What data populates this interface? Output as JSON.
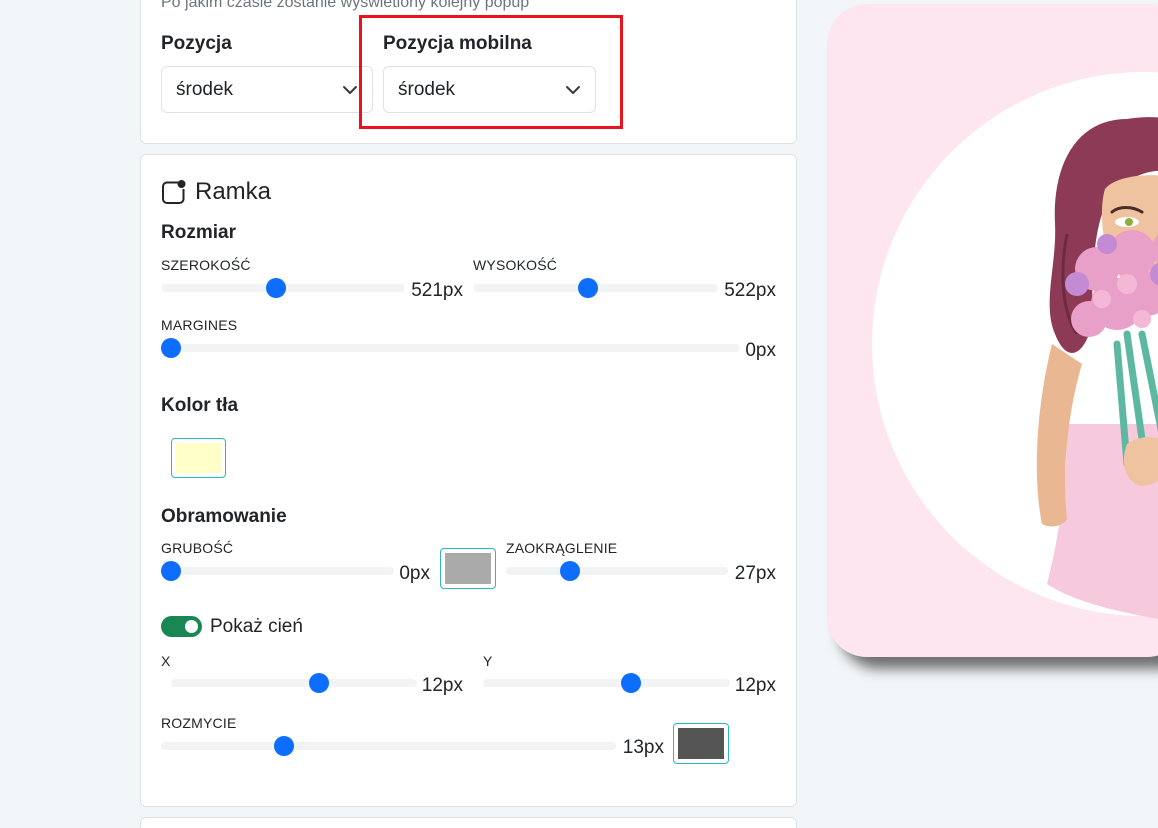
{
  "top_card": {
    "hint": "Po jakim czasie zostanie wyświetlony kolejny popup",
    "position_label": "Pozycja",
    "position_value": "środek",
    "mobile_position_label": "Pozycja mobilna",
    "mobile_position_value": "środek"
  },
  "frame": {
    "title": "Ramka",
    "size_heading": "Rozmiar",
    "width": {
      "label": "SZEROKOŚĆ",
      "value": "521px",
      "fraction": 0.47
    },
    "height": {
      "label": "WYSOKOŚĆ",
      "value": "522px",
      "fraction": 0.47
    },
    "margin": {
      "label": "MARGINES",
      "value": "0px",
      "fraction": 0.0
    },
    "bg_color_heading": "Kolor tła",
    "bg_color": "#ffffc8",
    "border_heading": "Obramowanie",
    "thickness": {
      "label": "GRUBOŚĆ",
      "value": "0px",
      "fraction": 0.0
    },
    "border_color": "#aaaaaa",
    "radius": {
      "label": "ZAOKRĄGLENIE",
      "value": "27px",
      "fraction": 0.29
    },
    "shadow_toggle_label": "Pokaż cień",
    "shadow_enabled": true,
    "shadow_x": {
      "label": "X",
      "value": "12px",
      "fraction": 0.6
    },
    "shadow_y": {
      "label": "Y",
      "value": "12px",
      "fraction": 0.6
    },
    "blur": {
      "label": "ROZMYCIE",
      "value": "13px",
      "fraction": 0.27
    },
    "shadow_color": "#555555"
  },
  "colors": {
    "accent": "#0d6efd",
    "toggle_on": "#198754",
    "highlight": "#e8141b"
  }
}
